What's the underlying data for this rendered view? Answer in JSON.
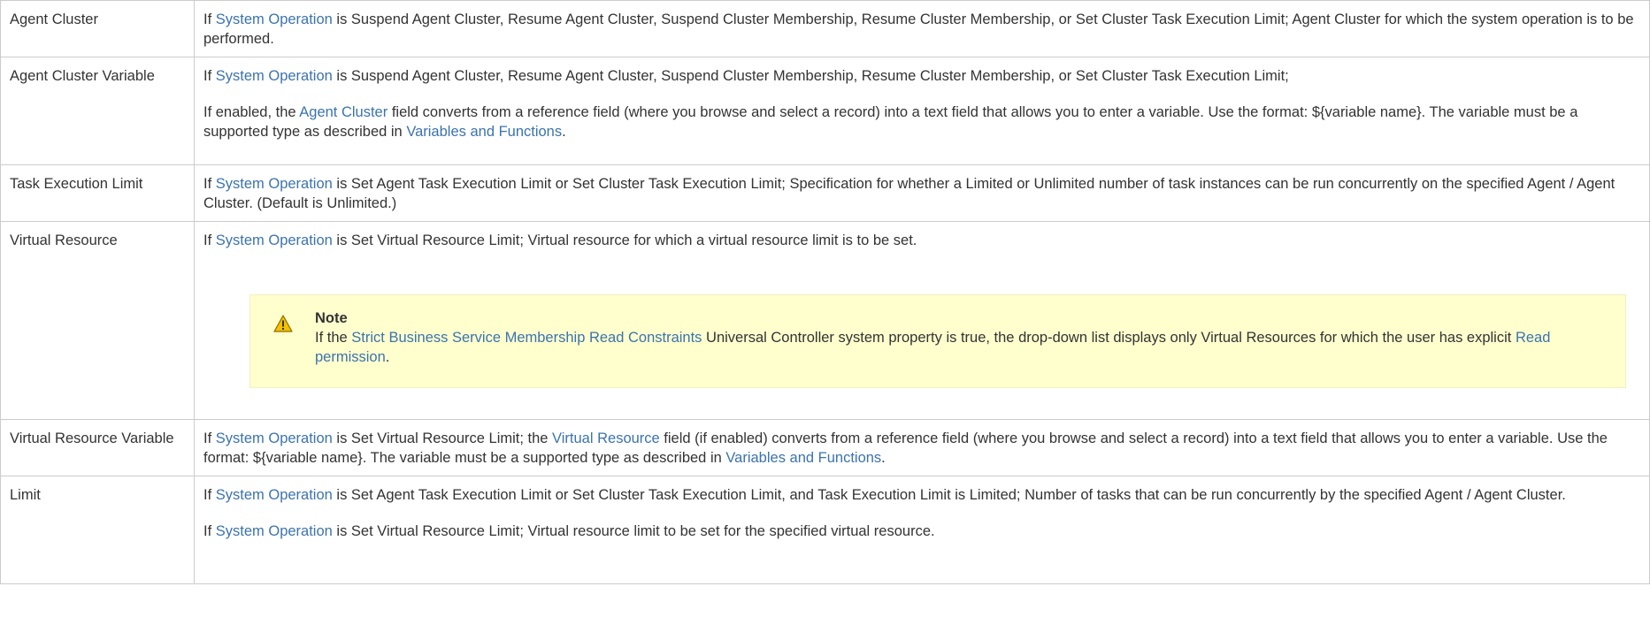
{
  "rows": [
    {
      "name": "Agent Cluster",
      "p1": {
        "pre": "If ",
        "link": "System Operation",
        "post": " is Suspend Agent Cluster, Resume Agent Cluster, Suspend Cluster Membership, Resume Cluster Membership, or Set Cluster Task Execution Limit; Agent Cluster for which the system operation is to be performed."
      }
    },
    {
      "name": "Agent Cluster Variable",
      "p1": {
        "pre": "If ",
        "link": "System Operation",
        "post": " is Suspend Agent Cluster, Resume Agent Cluster, Suspend Cluster Membership, Resume Cluster Membership, or Set Cluster Task Execution Limit;"
      },
      "p2": {
        "pre": "If enabled, the ",
        "link1": "Agent Cluster",
        "mid": " field converts from a reference field (where you browse and select a record) into a text field that allows you to enter a variable. Use the format: ${variable name}. The variable must be a supported type as described in ",
        "link2": "Variables and Functions",
        "post": "."
      }
    },
    {
      "name": "Task Execution Limit",
      "p1": {
        "pre": "If ",
        "link": "System Operation",
        "post": " is Set Agent Task Execution Limit or Set Cluster Task Execution Limit; Specification for whether a Limited or Unlimited number of task instances can be run concurrently on the specified Agent / Agent Cluster. (Default is Unlimited.)"
      }
    },
    {
      "name": "Virtual Resource",
      "p1": {
        "pre": "If ",
        "link": "System Operation",
        "post": " is Set Virtual Resource Limit; Virtual resource for which a virtual resource limit is to be set."
      },
      "note": {
        "icon": "warning-icon",
        "title": "Note",
        "pre": "If the ",
        "link1": "Strict Business Service Membership Read Constraints",
        "mid": " Universal Controller system property is true, the drop-down list displays only Virtual Resources for which the user has explicit ",
        "link2": "Read permission",
        "post": "."
      }
    },
    {
      "name": "Virtual Resource Variable",
      "p1": {
        "pre": "If ",
        "link1": "System Operation",
        "mid1": " is Set Virtual Resource Limit; the ",
        "link2": "Virtual Resource",
        "mid2": " field (if enabled) converts from a reference field (where you browse and select a record) into a text field that allows you to enter a variable. Use the format: ${variable name}. The variable must be a supported type as described in ",
        "link3": "Variables and Functions",
        "post": "."
      }
    },
    {
      "name": "Limit",
      "p1": {
        "pre": "If ",
        "link": "System Operation",
        "post": " is Set Agent Task Execution Limit or Set Cluster Task Execution Limit, and Task Execution Limit is Limited; Number of tasks that can be run concurrently by the specified Agent / Agent Cluster."
      },
      "p2": {
        "pre": "If ",
        "link": "System Operation",
        "post": " is Set Virtual Resource Limit; Virtual resource limit to be set for the specified virtual resource."
      }
    }
  ],
  "colors": {
    "link": "#3b73af",
    "border": "#cccccc",
    "note_bg": "#ffffce",
    "warning": "#f5c000"
  }
}
